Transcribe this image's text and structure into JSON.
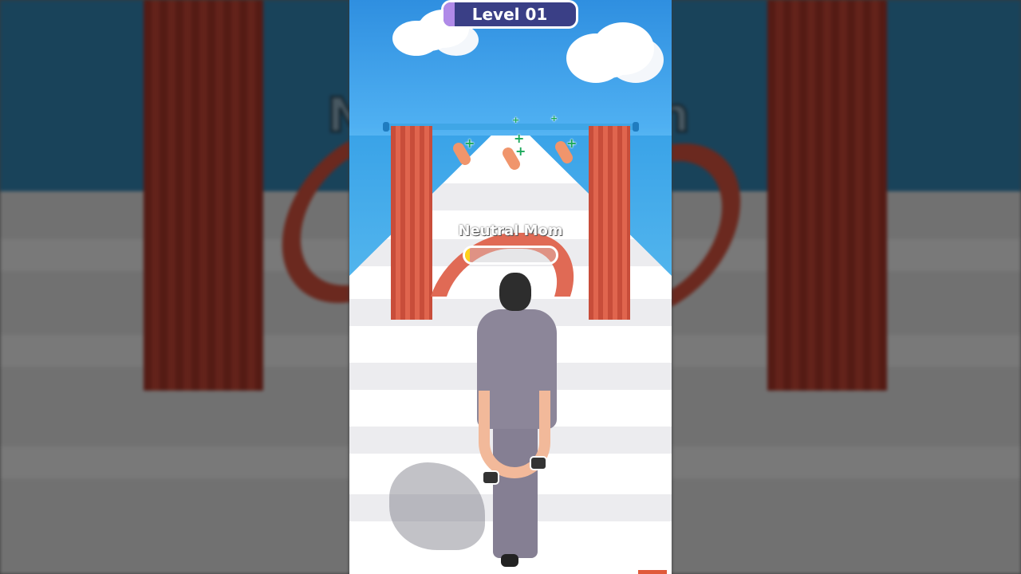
{
  "game": {
    "level_label": "Level 01",
    "gate_label": "Neutral Mom",
    "gate_meter_fraction": 0.05,
    "pickup_plus_symbol": "+"
  },
  "colors": {
    "pill_bg": "#3a3f86",
    "pill_accent": "#b08ae8",
    "curtain": "#e0654e",
    "meter_fill": "#ffd21a",
    "sky": "#4fb0f2"
  },
  "icons": {
    "cloud": "cloud-icon",
    "plus": "plus-icon"
  }
}
